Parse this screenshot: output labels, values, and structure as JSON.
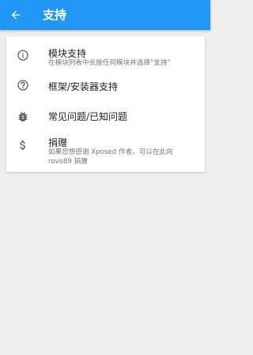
{
  "appbar": {
    "title": "支持",
    "background": "#2196f3"
  },
  "items": [
    {
      "icon": "info-icon",
      "title": "模块支持",
      "subtitle": "在模块列表中长按任何模块并选择“支持”"
    },
    {
      "icon": "help-icon",
      "title": "框架/安装器支持"
    },
    {
      "icon": "bug-icon",
      "title": "常见问题/已知问题"
    },
    {
      "icon": "dollar-icon",
      "title": "捐赠",
      "subtitle": "如果您想感谢 Xposed 作者，可以在此向 rovo89 捐赠"
    }
  ]
}
